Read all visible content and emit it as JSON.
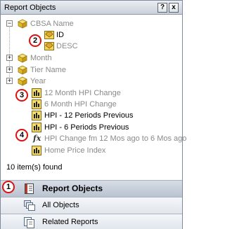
{
  "panel": {
    "title": "Report Objects",
    "help_label": "?",
    "close_label": "x"
  },
  "tree": {
    "items": [
      {
        "label": "CBSA Name",
        "type": "attribute",
        "state": "expanded",
        "color": "grey"
      },
      {
        "label": "ID",
        "type": "form",
        "color": "black"
      },
      {
        "label": "DESC",
        "type": "form",
        "color": "grey"
      },
      {
        "label": "Month",
        "type": "attribute",
        "state": "collapsed",
        "color": "grey"
      },
      {
        "label": "Tier Name",
        "type": "attribute",
        "state": "collapsed",
        "color": "grey"
      },
      {
        "label": "Year",
        "type": "attribute",
        "state": "collapsed",
        "color": "grey"
      },
      {
        "label": "12 Month HPI Change",
        "type": "metric",
        "color": "grey"
      },
      {
        "label": "6 Month HPI Change",
        "type": "metric",
        "color": "grey"
      },
      {
        "label": "HPI - 12 Periods Previous",
        "type": "metric",
        "color": "black"
      },
      {
        "label": "HPI - 6 Periods Previous",
        "type": "metric",
        "color": "black"
      },
      {
        "label": "HPI Change fm 12 Mos ago to 6 Mos ago",
        "type": "derived-metric",
        "color": "grey"
      },
      {
        "label": "Home Price Index",
        "type": "metric",
        "color": "grey"
      }
    ],
    "expanded_sign": "−",
    "collapsed_sign": "+",
    "fx_label": "fx",
    "found_text": "10 item(s) found"
  },
  "callouts": [
    "1",
    "2",
    "3",
    "4"
  ],
  "tabs": [
    {
      "label": "Report Objects",
      "icon": "report-objects-icon",
      "active": true
    },
    {
      "label": "All Objects",
      "icon": "all-objects-icon",
      "active": false
    },
    {
      "label": "Related Reports",
      "icon": "related-reports-icon",
      "active": false
    }
  ],
  "colors": {
    "grey_text": "#8a8a8a",
    "badge_red": "#dd1111",
    "active_tab": "#c2cbd8"
  }
}
